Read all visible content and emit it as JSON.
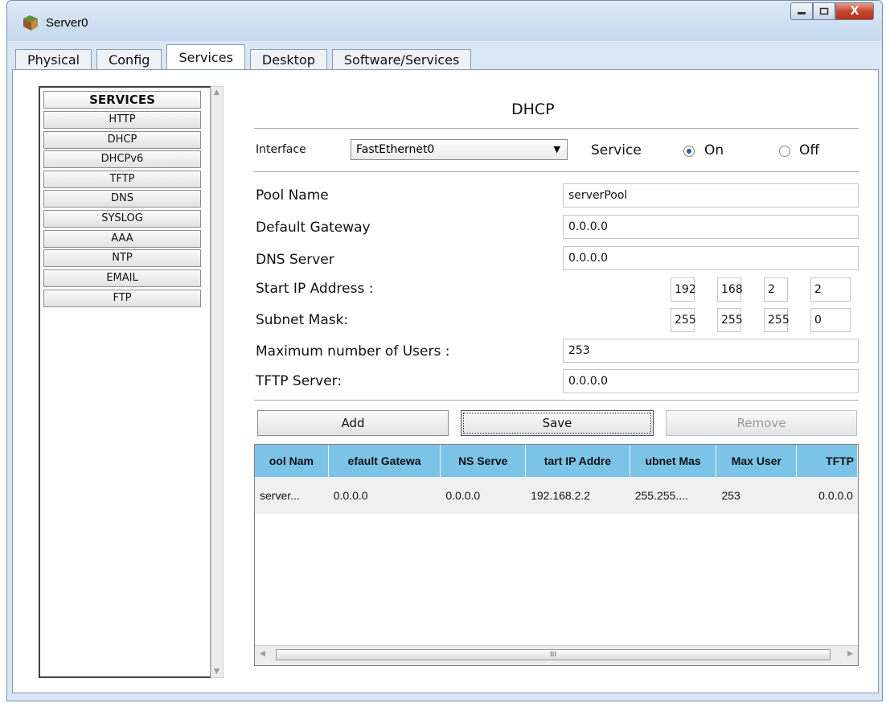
{
  "window": {
    "title": "Server0",
    "controls": {
      "minimize": "minimize-icon",
      "maximize": "maximize-icon",
      "close": "X"
    }
  },
  "tabs": [
    {
      "label": "Physical"
    },
    {
      "label": "Config"
    },
    {
      "label": "Services",
      "active": true
    },
    {
      "label": "Desktop"
    },
    {
      "label": "Software/Services"
    }
  ],
  "sidebar": {
    "items": [
      {
        "label": "SERVICES"
      },
      {
        "label": "HTTP"
      },
      {
        "label": "DHCP"
      },
      {
        "label": "DHCPv6"
      },
      {
        "label": "TFTP"
      },
      {
        "label": "DNS"
      },
      {
        "label": "SYSLOG"
      },
      {
        "label": "AAA"
      },
      {
        "label": "NTP"
      },
      {
        "label": "EMAIL"
      },
      {
        "label": "FTP"
      }
    ]
  },
  "dhcp": {
    "title": "DHCP",
    "interface_label": "Interface",
    "interface_value": "FastEthernet0",
    "service_label": "Service",
    "on_label": "On",
    "off_label": "Off",
    "service_on": true,
    "pool_name_label": "Pool Name",
    "pool_name_value": "serverPool",
    "default_gateway_label": "Default Gateway",
    "default_gateway_value": "0.0.0.0",
    "dns_server_label": "DNS Server",
    "dns_server_value": "0.0.0.0",
    "start_ip_label": "Start IP Address :",
    "start_ip": [
      "192",
      "168",
      "2",
      "2"
    ],
    "subnet_mask_label": "Subnet Mask:",
    "subnet_mask": [
      "255",
      "255",
      "255",
      "0"
    ],
    "max_users_label": "Maximum number of Users :",
    "max_users_value": "253",
    "tftp_server_label": "TFTP Server:",
    "tftp_server_value": "0.0.0.0",
    "add_label": "Add",
    "save_label": "Save",
    "remove_label": "Remove"
  },
  "table": {
    "headers": [
      "ool Nam",
      "efault Gatewa",
      "NS Serve",
      "tart IP Addre",
      "ubnet Mas",
      "Max User",
      "TFTP"
    ],
    "rows": [
      [
        "server...",
        "0.0.0.0",
        "0.0.0.0",
        "192.168.2.2",
        "255.255....",
        "253",
        "0.0.0.0"
      ]
    ],
    "scroll_thumb_mark": "III"
  }
}
